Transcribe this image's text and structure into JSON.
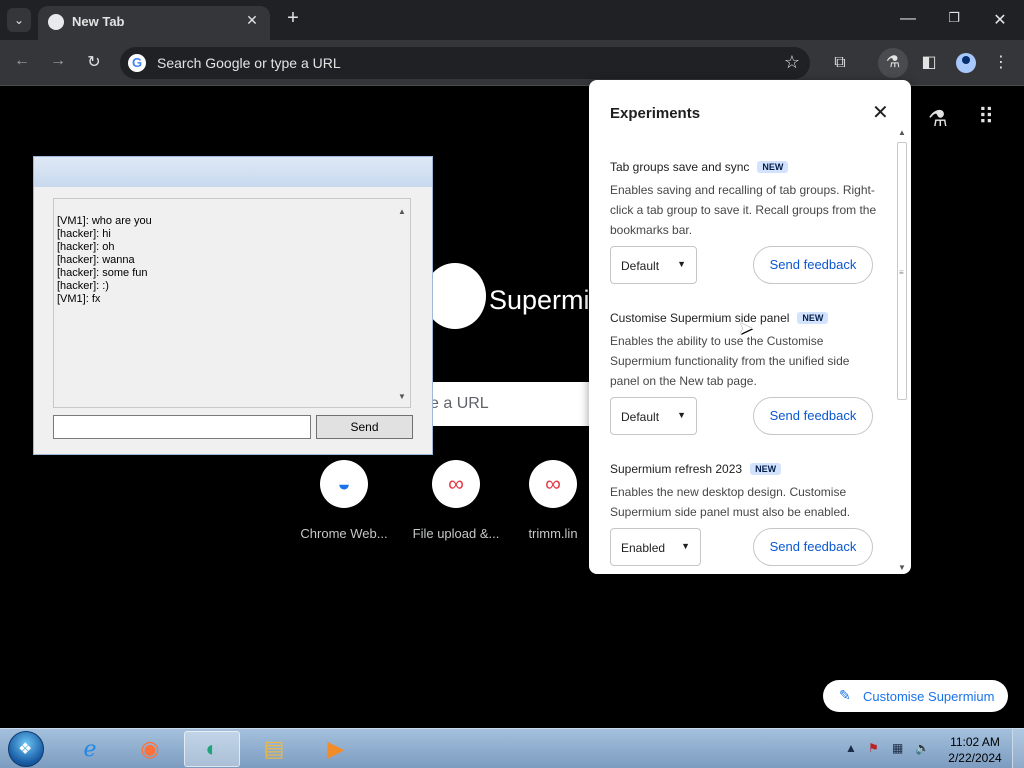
{
  "browser": {
    "tab_title": "New Tab",
    "omnibox_placeholder": "Search Google or type a URL"
  },
  "ntp": {
    "logo_text": "Supermiu",
    "search_placeholder": "e a URL",
    "shortcuts": [
      {
        "label": "Chrome Web..."
      },
      {
        "label": "File upload &..."
      },
      {
        "label": "trimm.lin"
      }
    ],
    "customise_button": "Customise Supermium"
  },
  "chat": {
    "messages": [
      "[VM1]: who are you",
      "[hacker]: hi",
      "[hacker]: oh",
      "[hacker]: wanna",
      "[hacker]: some fun",
      "[hacker]: :)",
      "[VM1]: fx"
    ],
    "input_value": "",
    "send_label": "Send"
  },
  "experiments": {
    "title": "Experiments",
    "items": [
      {
        "name": "Tab groups save and sync",
        "badge": "NEW",
        "description": "Enables saving and recalling of tab groups. Right-click a tab group to save it. Recall groups from the bookmarks bar.",
        "value": "Default",
        "feedback_label": "Send feedback"
      },
      {
        "name": "Customise Supermium side panel",
        "badge": "NEW",
        "description": "Enables the ability to use the Customise Supermium functionality from the unified side panel on the New tab page.",
        "value": "Default",
        "feedback_label": "Send feedback"
      },
      {
        "name": "Supermium refresh 2023",
        "badge": "NEW",
        "description": "Enables the new desktop design. Customise Supermium side panel must also be enabled.",
        "value": "Enabled",
        "feedback_label": "Send feedback"
      }
    ]
  },
  "taskbar": {
    "time": "11:02 AM",
    "date": "2/22/2024"
  },
  "colors": {
    "page_bg": "#000000",
    "chrome_dark": "#202124",
    "toolbar": "#35363a",
    "accent_blue": "#0b57d0",
    "badge_bg": "#d3e3fd"
  }
}
